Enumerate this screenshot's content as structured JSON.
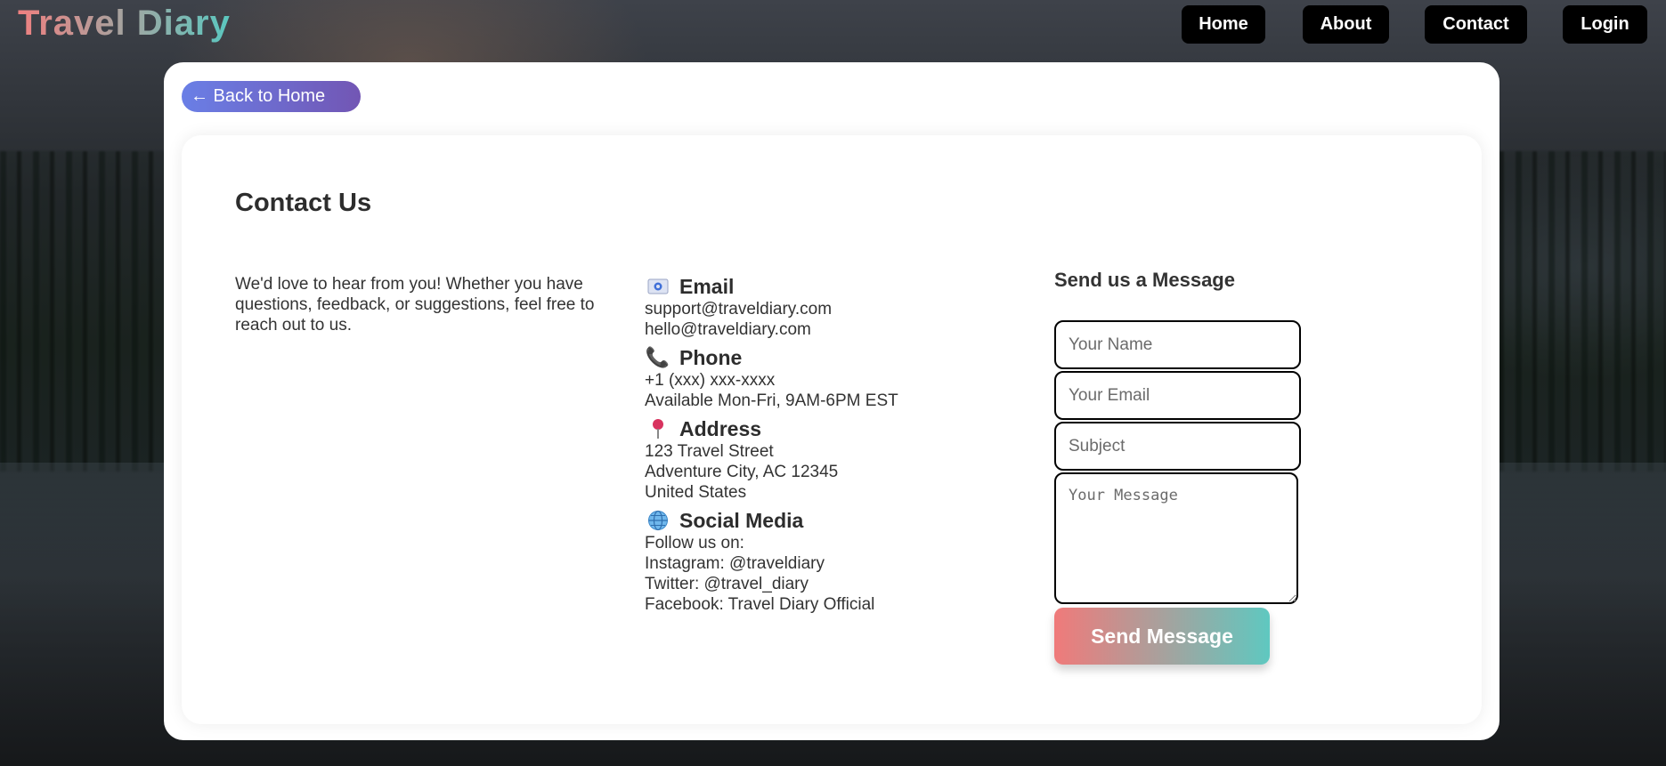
{
  "brand": "Travel Diary",
  "nav": {
    "home": "Home",
    "about": "About",
    "contact": "Contact",
    "login": "Login"
  },
  "back_label": "← Back to Home",
  "page_title": "Contact Us",
  "intro": "We'd love to hear from you! Whether you have questions, feedback, or suggestions, feel free to reach out to us.",
  "contact_info": {
    "email": {
      "icon": "email-icon",
      "heading": "Email",
      "lines": [
        "support@traveldiary.com",
        "hello@traveldiary.com"
      ]
    },
    "phone": {
      "icon": "phone-icon",
      "heading": "Phone",
      "lines": [
        "+1 (xxx) xxx-xxxx",
        "Available Mon-Fri, 9AM-6PM EST"
      ]
    },
    "address": {
      "icon": "pin-icon",
      "heading": "Address",
      "lines": [
        "123 Travel Street",
        "Adventure City, AC 12345",
        "United States"
      ]
    },
    "social": {
      "icon": "globe-icon",
      "heading": "Social Media",
      "lines": [
        "Follow us on:",
        "Instagram: @traveldiary",
        "Twitter: @travel_diary",
        "Facebook: Travel Diary Official"
      ]
    }
  },
  "form": {
    "title": "Send us a Message",
    "name_placeholder": "Your Name",
    "email_placeholder": "Your Email",
    "subject_placeholder": "Subject",
    "message_placeholder": "Your Message",
    "submit_label": "Send Message"
  },
  "colors": {
    "brand_gradient_start": "#f08080",
    "brand_gradient_end": "#5ac8c0",
    "back_button_start": "#6a7fe6",
    "back_button_end": "#7256b4",
    "nav_button": "#000000"
  }
}
